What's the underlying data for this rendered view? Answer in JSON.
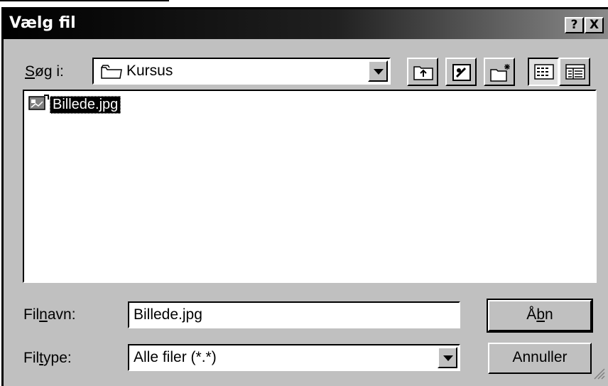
{
  "window": {
    "title": "Vælg fil",
    "help_button": "?",
    "close_button": "X"
  },
  "lookin": {
    "label_underlined": "S",
    "label_rest": "øg i:",
    "folder": "Kursus",
    "folder_icon": "folder-icon"
  },
  "toolbar": {
    "buttons": [
      "up-one-level-icon",
      "desktop-icon",
      "new-folder-icon",
      "list-view-icon",
      "details-view-icon"
    ]
  },
  "files": [
    {
      "name": "Billede.jpg",
      "icon": "image-file-icon",
      "selected": true
    }
  ],
  "filename": {
    "label_pre": "Fil",
    "label_underlined": "n",
    "label_post": "avn:",
    "value": "Billede.jpg"
  },
  "filetype": {
    "label_pre": "Fil",
    "label_underlined": "t",
    "label_post": "ype:",
    "value": "Alle filer (*.*)"
  },
  "buttons": {
    "open_pre": "Å",
    "open_underlined": "b",
    "open_post": "n",
    "cancel": "Annuller"
  }
}
